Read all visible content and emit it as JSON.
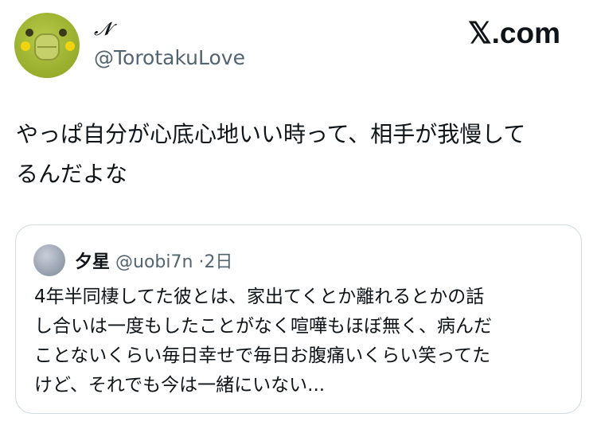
{
  "author": {
    "display_name": "𝓝",
    "handle": "@TorotakuLove",
    "avatar_icon": "frog-avatar-icon"
  },
  "brand": {
    "logo_text": "𝕏.com"
  },
  "tweet": {
    "text_line1": "やっぱ自分が心底心地いい時って、相手が我慢して",
    "text_line2": "るんだよな"
  },
  "quoted_tweet": {
    "display_name": "夕星",
    "handle": "@uobi7n",
    "separator": "·",
    "time": "2日",
    "avatar_icon": "user-avatar-icon",
    "lines": [
      "4年半同棲してた彼とは、家出てくとか離れるとかの話",
      "し合いは一度もしたことがなく喧嘩もほぼ無く、病んだ",
      "ことないくらい毎日幸せで毎日お腹痛いくらい笑ってた",
      "けど、それでも今は一緒にいない..."
    ]
  },
  "colors": {
    "text": "#0f1419",
    "secondary": "#536471",
    "border": "#cfd9de"
  }
}
